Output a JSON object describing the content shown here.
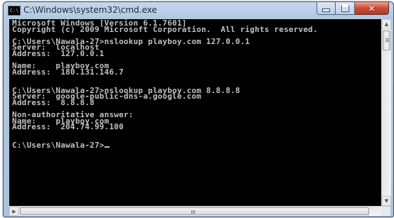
{
  "window": {
    "title": "C:\\Windows\\system32\\cmd.exe",
    "icon": "cmd-icon",
    "icon_text": "C:\\",
    "controls": {
      "minimize": "minimize-icon",
      "maximize": "maximize-icon",
      "close": "close-icon",
      "close_glyph": "✕"
    }
  },
  "console": {
    "lines": [
      "Microsoft Windows [Version 6.1.7601]",
      "Copyright (c) 2009 Microsoft Corporation.  All rights reserved.",
      "",
      "C:\\Users\\Nawala-27>nslookup playboy.com 127.0.0.1",
      "Server:  localhost",
      "Address:  127.0.0.1",
      "",
      "Name:    playboy.com",
      "Address:  180.131.146.7",
      "",
      "",
      "C:\\Users\\Nawala-27>nslookup playboy.com 8.8.8.8",
      "Server:  google-public-dns-a.google.com",
      "Address:  8.8.8.8",
      "",
      "Non-authoritative answer:",
      "Name:    playboy.com",
      "Address:  204.74.99.100",
      "",
      "",
      "C:\\Users\\Nawala-27>"
    ]
  },
  "scrollbars": {
    "up_glyph": "▲",
    "down_glyph": "▼",
    "left_glyph": "◀",
    "right_glyph": "▶"
  }
}
